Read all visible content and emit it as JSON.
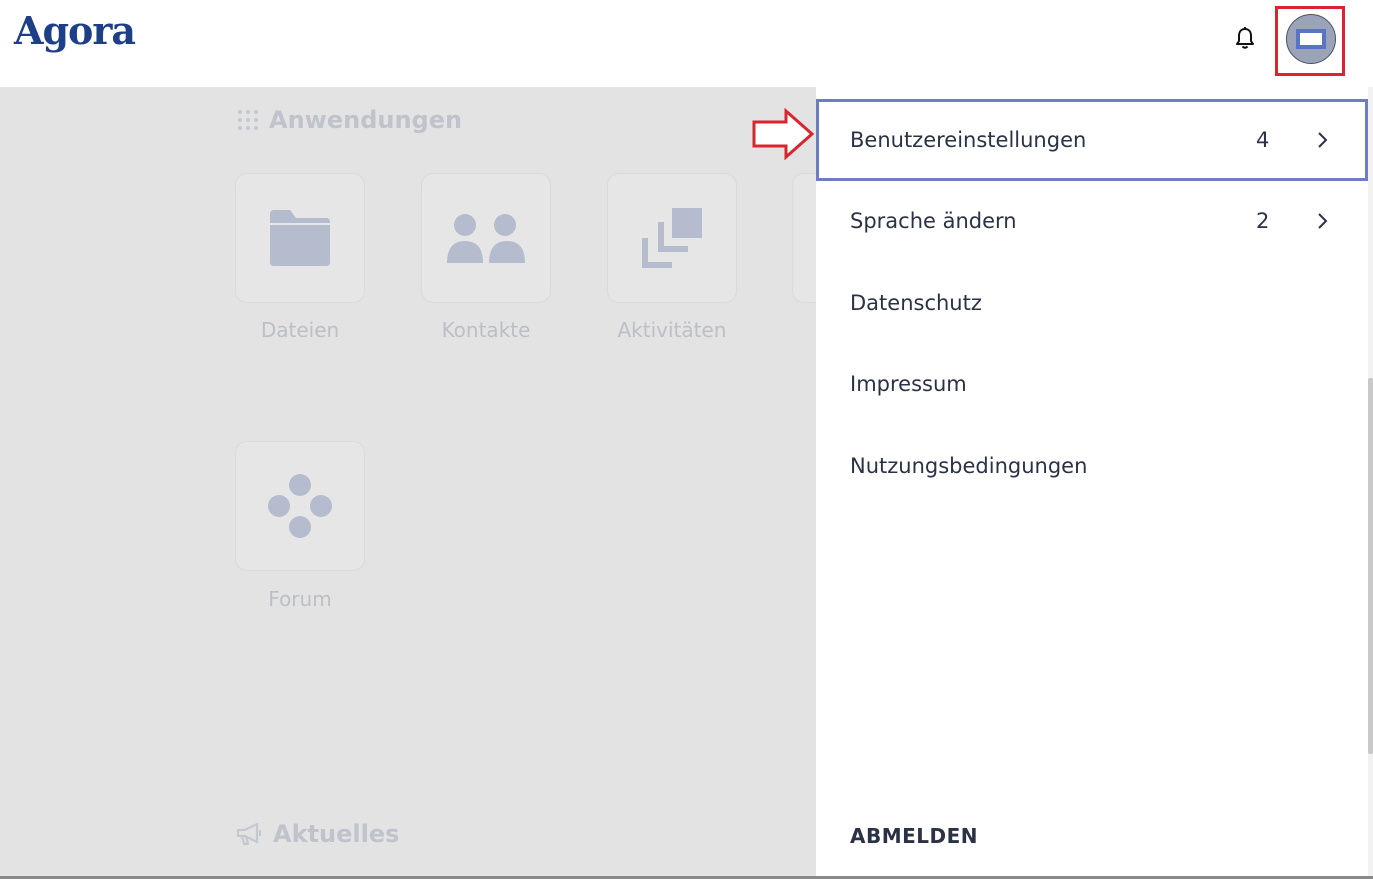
{
  "header": {
    "logo_text": "Agora",
    "bell_icon": "bell-icon",
    "avatar_icon": "avatar-icon"
  },
  "main": {
    "apps_title": "Anwendungen",
    "apps": [
      {
        "label": "Dateien",
        "icon": "folder-icon"
      },
      {
        "label": "Kontakte",
        "icon": "contacts-icon"
      },
      {
        "label": "Aktivitäten",
        "icon": "activities-icon"
      },
      {
        "label": "Forum",
        "icon": "forum-icon"
      }
    ],
    "news_title": "Aktuelles"
  },
  "menu": {
    "items": [
      {
        "label": "Benutzereinstellungen",
        "count": "4",
        "has_submenu": true
      },
      {
        "label": "Sprache ändern",
        "count": "2",
        "has_submenu": true
      },
      {
        "label": "Datenschutz"
      },
      {
        "label": "Impressum"
      },
      {
        "label": "Nutzungsbedingungen"
      }
    ],
    "logout_label": "ABMELDEN"
  },
  "colors": {
    "brand": "#1d3f8a",
    "highlight_red": "#d9252e",
    "active_border": "#6e7cc4",
    "dim_background": "#e3e3e3",
    "icon_muted": "#b4bccd"
  }
}
